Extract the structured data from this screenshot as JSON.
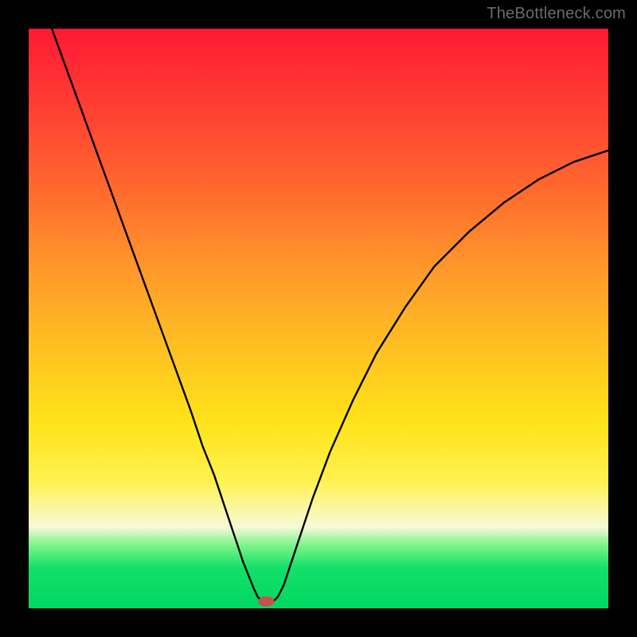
{
  "watermark": "TheBottleneck.com",
  "chart_data": {
    "type": "line",
    "title": "",
    "xlabel": "",
    "ylabel": "",
    "xlim": [
      0,
      100
    ],
    "ylim": [
      0,
      100
    ],
    "gradient_stops": [
      {
        "pct": 0,
        "color": "#ff1a33"
      },
      {
        "pct": 12,
        "color": "#ff3a33"
      },
      {
        "pct": 28,
        "color": "#ff6a2e"
      },
      {
        "pct": 42,
        "color": "#ff9a2a"
      },
      {
        "pct": 55,
        "color": "#ffc022"
      },
      {
        "pct": 68,
        "color": "#ffe31a"
      },
      {
        "pct": 78,
        "color": "#fff150"
      },
      {
        "pct": 83,
        "color": "#fbf7a8"
      },
      {
        "pct": 86,
        "color": "#f6f9d7"
      },
      {
        "pct": 89,
        "color": "#7ff58a"
      },
      {
        "pct": 93,
        "color": "#14e06a"
      },
      {
        "pct": 100,
        "color": "#00d861"
      }
    ],
    "series": [
      {
        "name": "bottleneck-curve",
        "points_xy": [
          [
            4,
            100
          ],
          [
            8,
            89
          ],
          [
            12,
            78
          ],
          [
            16,
            67
          ],
          [
            20,
            56
          ],
          [
            24,
            45
          ],
          [
            28,
            34
          ],
          [
            30,
            28
          ],
          [
            32,
            23
          ],
          [
            34,
            17
          ],
          [
            36,
            11
          ],
          [
            37,
            8
          ],
          [
            38,
            5.5
          ],
          [
            38.8,
            3.5
          ],
          [
            39.5,
            2.0
          ],
          [
            40.2,
            1.2
          ],
          [
            41,
            0.8
          ],
          [
            42,
            1.0
          ],
          [
            43,
            2.0
          ],
          [
            44,
            4.0
          ],
          [
            45,
            7.0
          ],
          [
            47,
            13
          ],
          [
            49,
            19
          ],
          [
            52,
            27
          ],
          [
            56,
            36
          ],
          [
            60,
            44
          ],
          [
            65,
            52
          ],
          [
            70,
            59
          ],
          [
            76,
            65
          ],
          [
            82,
            70
          ],
          [
            88,
            74
          ],
          [
            94,
            77
          ],
          [
            100,
            79
          ]
        ]
      }
    ],
    "marker": {
      "name": "minimum-marker",
      "x": 41,
      "y": 1.2,
      "rx": 1.4,
      "ry": 0.9,
      "color": "#c5524d"
    }
  }
}
